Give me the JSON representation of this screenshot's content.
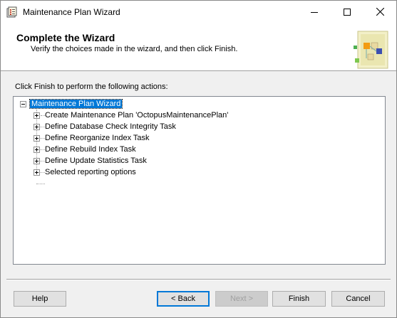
{
  "window": {
    "title": "Maintenance Plan Wizard",
    "app_icon": "maintenance-plan-icon",
    "caption_buttons": [
      "minimize-icon",
      "maximize-icon",
      "close-icon"
    ]
  },
  "header": {
    "title": "Complete the Wizard",
    "subtitle": "Verify the choices made in the wizard, and then click Finish."
  },
  "body": {
    "instruction": "Click Finish to perform the following actions:",
    "tree": {
      "root": "Maintenance Plan Wizard",
      "items": [
        "Create Maintenance Plan 'OctopusMaintenancePlan'",
        "Define Database Check Integrity Task",
        "Define Reorganize Index Task",
        "Define Rebuild Index Task",
        "Define Update Statistics Task",
        "Selected reporting options"
      ]
    }
  },
  "buttons": {
    "help": "Help",
    "back": "< Back",
    "next": "Next >",
    "finish": "Finish",
    "cancel": "Cancel"
  },
  "colors": {
    "selection": "#0078d7",
    "header_bg": "#ffffff",
    "dialog_bg": "#f0f0f0"
  }
}
